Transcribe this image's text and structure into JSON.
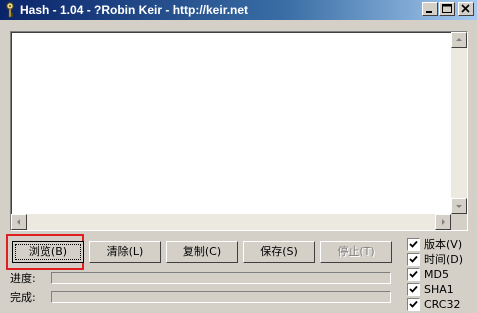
{
  "window": {
    "title": "Hash - 1.04 - ?Robin Keir - http://keir.net",
    "icon": "key-icon",
    "controls": [
      "minimize-icon",
      "maximize-icon",
      "close-icon"
    ]
  },
  "output": {
    "text": ""
  },
  "buttons": {
    "browse": "浏览(B)",
    "clear": "清除(L)",
    "copy": "复制(C)",
    "save": "保存(S)",
    "stop": "停止(T)"
  },
  "progress": {
    "progress_label": "进度:",
    "done_label": "完成:",
    "progress_value": 0,
    "done_value": 0
  },
  "options": [
    {
      "label": "版本(V)",
      "checked": true
    },
    {
      "label": "时间(D)",
      "checked": true
    },
    {
      "label": "MD5",
      "checked": true
    },
    {
      "label": "SHA1",
      "checked": true
    },
    {
      "label": "CRC32",
      "checked": true
    }
  ],
  "colors": {
    "titlebar_start": "#0a246a",
    "titlebar_end": "#a6caf0",
    "face": "#d4d0c8",
    "highlight_box": "#e02020"
  }
}
